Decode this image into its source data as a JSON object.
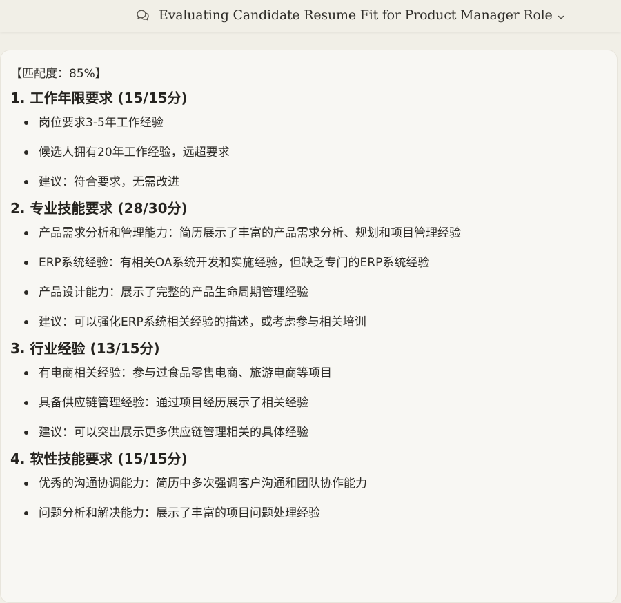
{
  "header": {
    "title": "Evaluating Candidate Resume Fit for Product Manager Role",
    "chat_icon": "chat-bubbles-icon",
    "dropdown_icon": "chevron-down-icon"
  },
  "content": {
    "match": "【匹配度：85%】",
    "sections": [
      {
        "title": "1. 工作年限要求 (15/15分)",
        "items": [
          "岗位要求3-5年工作经验",
          "候选人拥有20年工作经验，远超要求",
          "建议：符合要求，无需改进"
        ]
      },
      {
        "title": "2. 专业技能要求 (28/30分)",
        "items": [
          "产品需求分析和管理能力：简历展示了丰富的产品需求分析、规划和项目管理经验",
          "ERP系统经验：有相关OA系统开发和实施经验，但缺乏专门的ERP系统经验",
          "产品设计能力：展示了完整的产品生命周期管理经验",
          "建议：可以强化ERP系统相关经验的描述，或考虑参与相关培训"
        ]
      },
      {
        "title": "3. 行业经验 (13/15分)",
        "items": [
          "有电商相关经验：参与过食品零售电商、旅游电商等项目",
          "具备供应链管理经验：通过项目经历展示了相关经验",
          "建议：可以突出展示更多供应链管理相关的具体经验"
        ]
      },
      {
        "title": "4. 软性技能要求 (15/15分)",
        "items": [
          "优秀的沟通协调能力：简历中多次强调客户沟通和团队协作能力",
          "问题分析和解决能力：展示了丰富的项目问题处理经验"
        ]
      }
    ]
  }
}
